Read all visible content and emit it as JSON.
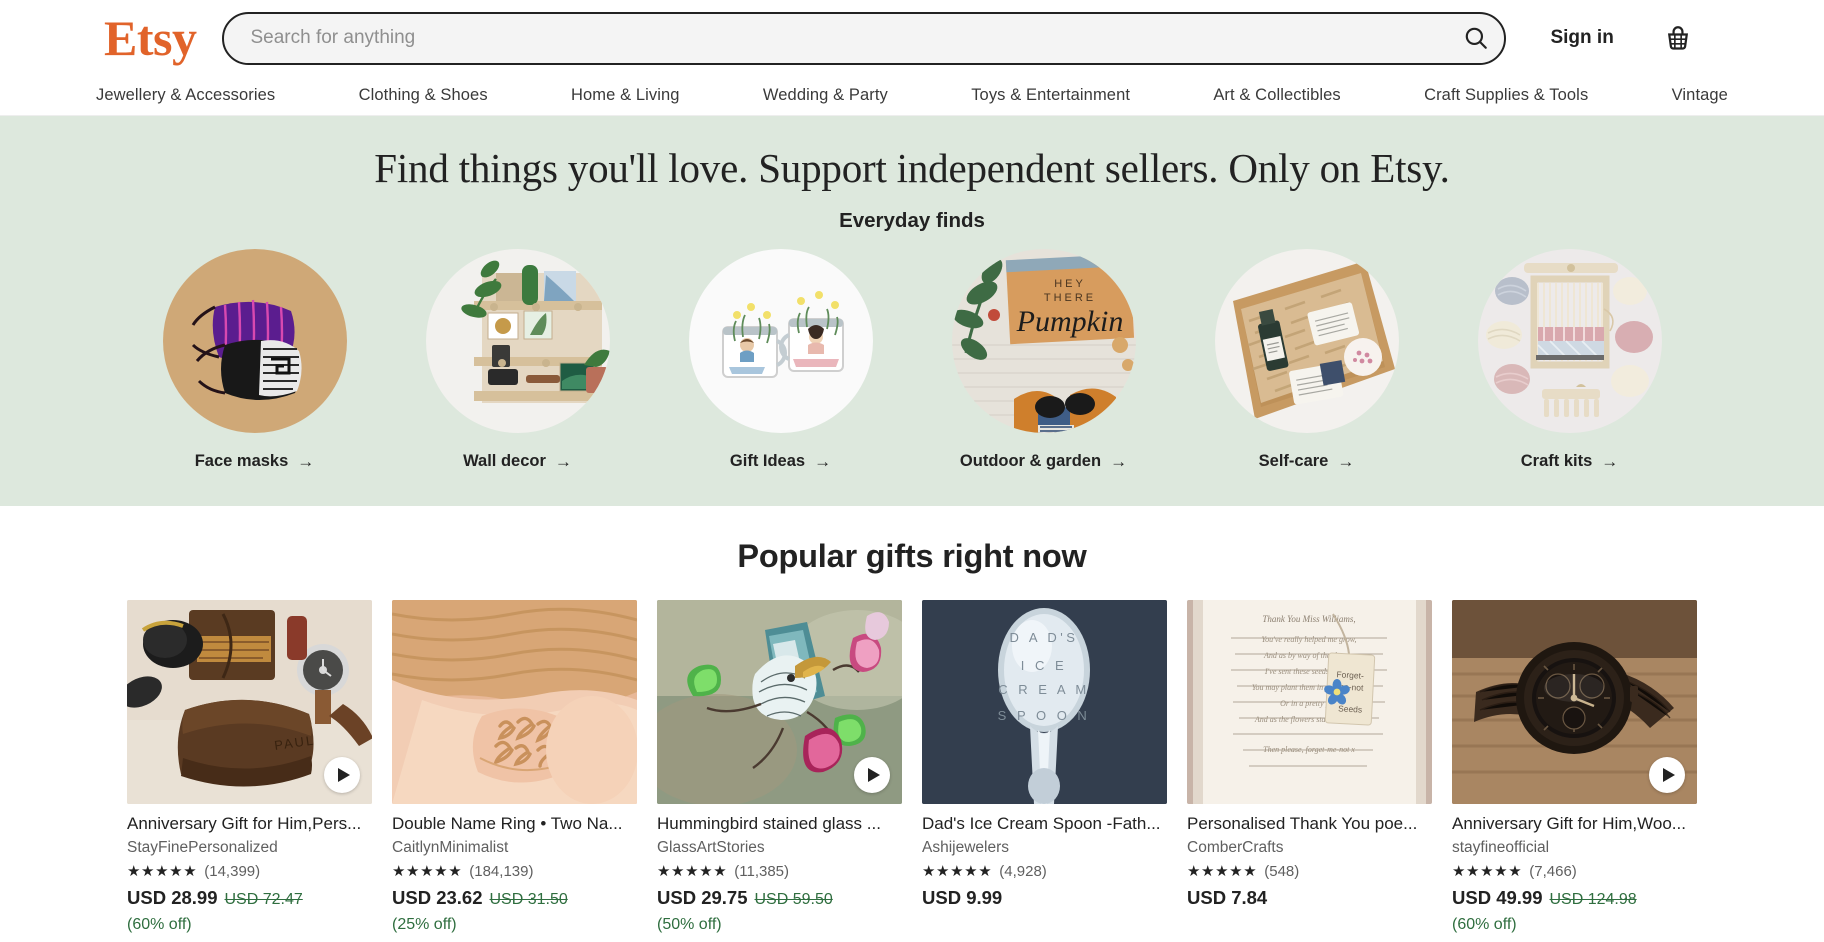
{
  "header": {
    "logo_text": "Etsy",
    "logo_color": "#e1632a",
    "search": {
      "placeholder": "Search for anything",
      "value": "",
      "icon": "search-icon"
    },
    "sign_in_label": "Sign in",
    "cart_icon": "basket-icon"
  },
  "nav": {
    "items": [
      {
        "label": "Jewellery & Accessories"
      },
      {
        "label": "Clothing & Shoes"
      },
      {
        "label": "Home & Living"
      },
      {
        "label": "Wedding & Party"
      },
      {
        "label": "Toys & Entertainment"
      },
      {
        "label": "Art & Collectibles"
      },
      {
        "label": "Craft Supplies & Tools"
      },
      {
        "label": "Vintage"
      }
    ]
  },
  "hero": {
    "background_color": "#dde8dd",
    "title": "Find things you'll love. Support independent sellers. Only on Etsy.",
    "subtitle": "Everyday finds",
    "categories": [
      {
        "label": "Face masks",
        "arrow": "→",
        "image": "face-masks-photo"
      },
      {
        "label": "Wall decor",
        "arrow": "→",
        "image": "wall-decor-photo"
      },
      {
        "label": "Gift Ideas",
        "arrow": "→",
        "image": "gift-ideas-photo"
      },
      {
        "label": "Outdoor & garden",
        "arrow": "→",
        "image": "outdoor-garden-photo"
      },
      {
        "label": "Self-care",
        "arrow": "→",
        "image": "self-care-photo"
      },
      {
        "label": "Craft kits",
        "arrow": "→",
        "image": "craft-kits-photo"
      }
    ]
  },
  "popular": {
    "title": "Popular gifts right now",
    "products": [
      {
        "title": "Anniversary Gift for Him,Pers...",
        "shop": "StayFinePersonalized",
        "stars": "★★★★★",
        "reviews": "(14,399)",
        "price": "USD 28.99",
        "price_original": "USD 72.47",
        "discount": "(60% off)",
        "has_video": true,
        "image": "leather-wallet-photo"
      },
      {
        "title": "Double Name Ring • Two Na...",
        "shop": "CaitlynMinimalist",
        "stars": "★★★★★",
        "reviews": "(184,139)",
        "price": "USD 23.62",
        "price_original": "USD 31.50",
        "discount": "(25% off)",
        "has_video": false,
        "image": "name-ring-photo"
      },
      {
        "title": "Hummingbird stained glass ...",
        "shop": "GlassArtStories",
        "stars": "★★★★★",
        "reviews": "(11,385)",
        "price": "USD 29.75",
        "price_original": "USD 59.50",
        "discount": "(50% off)",
        "has_video": true,
        "image": "stained-glass-hummingbird-photo"
      },
      {
        "title": "Dad's Ice Cream Spoon -Fath...",
        "shop": "Ashijewelers",
        "stars": "★★★★★",
        "reviews": "(4,928)",
        "price": "USD 9.99",
        "price_original": "",
        "discount": "",
        "has_video": false,
        "image": "stamped-spoon-photo"
      },
      {
        "title": "Personalised Thank You poe...",
        "shop": "ComberCrafts",
        "stars": "★★★★★",
        "reviews": "(548)",
        "price": "USD 7.84",
        "price_original": "",
        "discount": "",
        "has_video": false,
        "image": "thank-you-card-photo"
      },
      {
        "title": "Anniversary Gift for Him,Woo...",
        "shop": "stayfineofficial",
        "stars": "★★★★★",
        "reviews": "(7,466)",
        "price": "USD 49.99",
        "price_original": "USD 124.98",
        "discount": "(60% off)",
        "has_video": true,
        "image": "wooden-watch-photo"
      }
    ]
  }
}
